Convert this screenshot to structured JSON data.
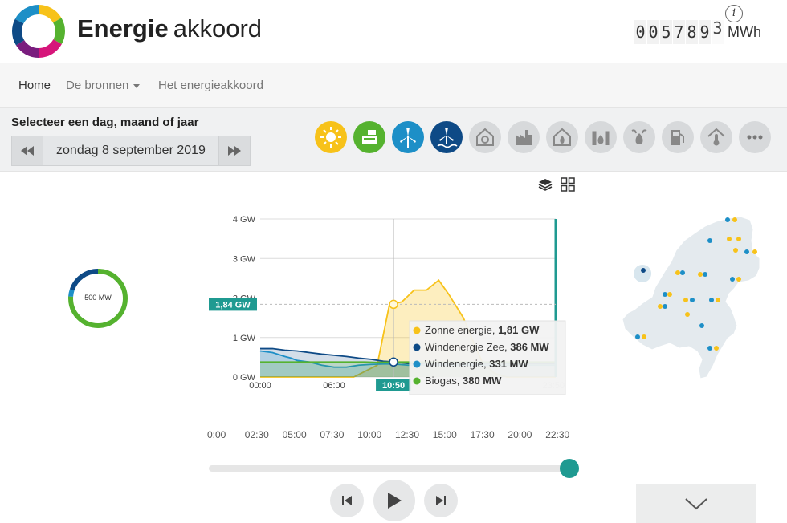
{
  "header": {
    "brand_bold": "Energie",
    "brand_light": "akkoord",
    "counter_digits": [
      "0",
      "0",
      "5",
      "7",
      "8",
      "9",
      "3"
    ],
    "counter_unit": "MWh",
    "info_label": "i"
  },
  "nav": {
    "items": [
      {
        "label": "Home",
        "active": true
      },
      {
        "label": "De bronnen",
        "dropdown": true
      },
      {
        "label": "Het energieakkoord"
      }
    ]
  },
  "toolbar": {
    "select_title": "Selecteer een dag, maand of jaar",
    "date": "zondag 8 september 2019",
    "prev_icon": "rewind-icon",
    "next_icon": "fast-forward-icon",
    "sources": [
      {
        "name": "sun-icon",
        "color": "#f7c21a"
      },
      {
        "name": "biogas-icon",
        "color": "#55b22f"
      },
      {
        "name": "wind-icon",
        "color": "#1d8fc7"
      },
      {
        "name": "offshore-wind-icon",
        "color": "#0e4a86"
      },
      {
        "name": "heat-pump-icon",
        "color": "#d7d9db"
      },
      {
        "name": "factory-icon",
        "color": "#d7d9db"
      },
      {
        "name": "house-fire-icon",
        "color": "#d7d9db"
      },
      {
        "name": "industrial-fire-icon",
        "color": "#d7d9db"
      },
      {
        "name": "biomass-icon",
        "color": "#d7d9db"
      },
      {
        "name": "fuel-pump-icon",
        "color": "#d7d9db"
      },
      {
        "name": "geothermal-icon",
        "color": "#d7d9db"
      },
      {
        "name": "more-icon",
        "color": "#d7d9db"
      }
    ]
  },
  "donut": {
    "label": "500 MW",
    "segments": [
      {
        "color": "#55b22f",
        "fraction": 0.76
      },
      {
        "color": "#1d8fc7",
        "fraction": 0.04
      },
      {
        "color": "#0e4a86",
        "fraction": 0.2
      }
    ]
  },
  "chart_data": {
    "type": "area",
    "y_ticks": [
      "4 GW",
      "3 GW",
      "2 GW",
      "1 GW",
      "0 GW"
    ],
    "ylim": [
      0,
      4
    ],
    "x_ticks": [
      "00:00",
      "06:00",
      "23:50"
    ],
    "xlim": [
      0,
      24
    ],
    "cursor_time": "10:50",
    "cursor_value_label": "1,84 GW",
    "series": [
      {
        "name": "Zonne energie",
        "color": "#f7c21a",
        "x": [
          0,
          7.6,
          9.5,
          10.5,
          11.5,
          12.5,
          13.5,
          14.5,
          15.3,
          16.5,
          17.3,
          18.0,
          19.0,
          20.0,
          24
        ],
        "y": [
          0,
          0,
          0.3,
          1.84,
          1.9,
          2.2,
          2.2,
          2.45,
          2.1,
          1.5,
          0.9,
          0.4,
          0.1,
          0,
          0
        ]
      },
      {
        "name": "Windenergie Zee",
        "color": "#0e4a86",
        "x": [
          0,
          1,
          2,
          3,
          4,
          5,
          6,
          7,
          8,
          9,
          10,
          10.83,
          11.5,
          12,
          24
        ],
        "y": [
          0.72,
          0.72,
          0.68,
          0.66,
          0.62,
          0.58,
          0.55,
          0.52,
          0.48,
          0.45,
          0.4,
          0.386,
          0.36,
          0.34,
          0.34
        ]
      },
      {
        "name": "Windenergie",
        "color": "#1d8fc7",
        "x": [
          0,
          1,
          2,
          2.5,
          3,
          4,
          5,
          6,
          7,
          8,
          9,
          10,
          10.83,
          12,
          24
        ],
        "y": [
          0.66,
          0.62,
          0.52,
          0.48,
          0.42,
          0.38,
          0.3,
          0.25,
          0.25,
          0.3,
          0.32,
          0.33,
          0.331,
          0.3,
          0.3
        ]
      },
      {
        "name": "Biogas",
        "color": "#55b22f",
        "x": [
          0,
          6,
          8.5,
          9.5,
          10.83,
          12,
          24
        ],
        "y": [
          0.38,
          0.38,
          0.38,
          0.37,
          0.38,
          0.38,
          0.38
        ]
      }
    ],
    "tooltip": [
      {
        "name": "Zonne energie",
        "value": "1,81 GW",
        "color": "#f7c21a"
      },
      {
        "name": "Windenergie Zee",
        "value": "386 MW",
        "color": "#0e4a86"
      },
      {
        "name": "Windenergie",
        "value": "331 MW",
        "color": "#1d8fc7"
      },
      {
        "name": "Biogas",
        "value": "380 MW",
        "color": "#55b22f"
      }
    ]
  },
  "timeline": {
    "labels": [
      "0:00",
      "02:30",
      "05:00",
      "07:30",
      "10:00",
      "12:30",
      "15:00",
      "17:30",
      "20:00",
      "22:30"
    ],
    "position": 0.99
  },
  "player": {
    "prev_icon": "skip-back-icon",
    "play_icon": "play-icon",
    "next_icon": "skip-forward-icon"
  },
  "view_icons": [
    "layers-icon",
    "grid-icon"
  ],
  "collapse_icon": "chevron-down-icon"
}
